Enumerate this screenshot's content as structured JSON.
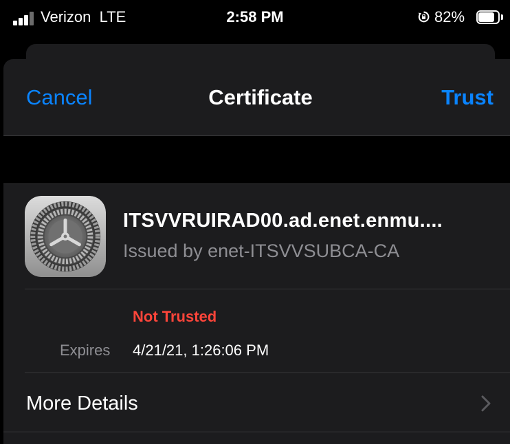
{
  "status_bar": {
    "carrier": "Verizon",
    "network": "LTE",
    "time": "2:58 PM",
    "battery_percent": "82%",
    "battery_level": 0.82,
    "icons": [
      "signal-icon",
      "rotation-lock-icon",
      "battery-icon"
    ]
  },
  "nav": {
    "cancel_label": "Cancel",
    "title": "Certificate",
    "trust_label": "Trust"
  },
  "certificate": {
    "icon": "settings-gear-icon",
    "name": "ITSVVRUIRAD00.ad.enet.enmu....",
    "issuer": "Issued by enet-ITSVVSUBCA-CA",
    "status": "Not Trusted",
    "expires_label": "Expires",
    "expires_value": "4/21/21, 1:26:06 PM"
  },
  "more_details": {
    "label": "More Details",
    "icon": "chevron-right-icon"
  },
  "colors": {
    "accent": "#0a84ff",
    "danger": "#ff453a",
    "sheet_bg": "#1c1c1e",
    "secondary_text": "#8e8e93"
  }
}
